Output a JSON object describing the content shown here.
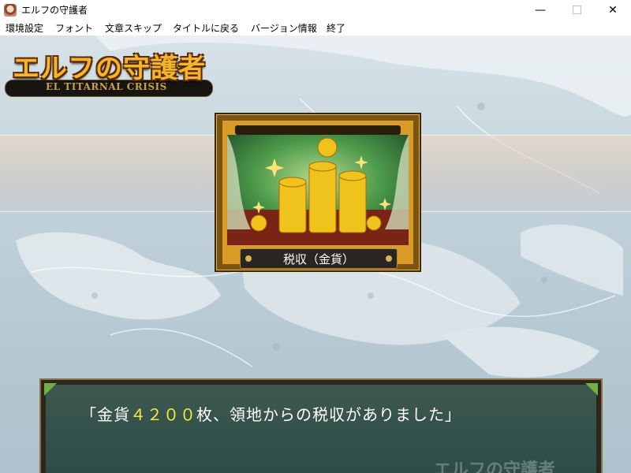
{
  "window": {
    "title": "エルフの守護者",
    "minimize_glyph": "—",
    "close_glyph": "✕"
  },
  "menu": [
    "環境設定",
    "フォント",
    "文章スキップ",
    "タイトルに戻る",
    "バージョン情報",
    "終了"
  ],
  "logo": {
    "title": "エルフの守護者",
    "subtitle": "EL TITARNAL CRISIS"
  },
  "event_panel": {
    "label": "税収（金貨）",
    "icon": "gold-coins-icon"
  },
  "message": {
    "open": "「金貨",
    "amount": "４２００",
    "rest": "枚、領地からの税収がありました」"
  },
  "message_box": {
    "watermark": "エルフの守護者"
  },
  "colors": {
    "accent_gold": "#f3b52a",
    "message_number": "#f4ea3a",
    "message_bg": "#33504b"
  }
}
